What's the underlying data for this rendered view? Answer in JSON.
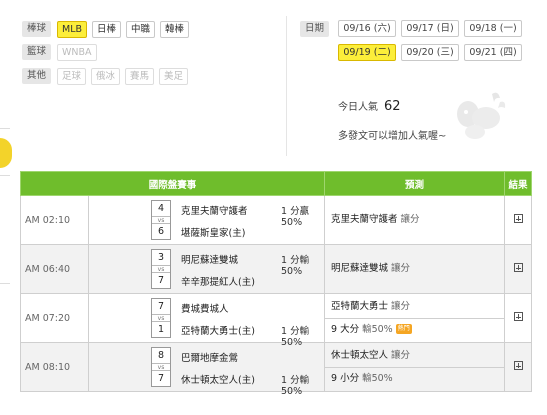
{
  "filters": {
    "rows": [
      {
        "label": "棒球",
        "chips": [
          {
            "text": "MLB",
            "state": "active"
          },
          {
            "text": "日棒",
            "state": "normal"
          },
          {
            "text": "中職",
            "state": "normal"
          },
          {
            "text": "韓棒",
            "state": "normal"
          }
        ]
      },
      {
        "label": "籃球",
        "chips": [
          {
            "text": "WNBA",
            "state": "disabled"
          }
        ]
      },
      {
        "label": "其他",
        "chips": [
          {
            "text": "足球",
            "state": "disabled"
          },
          {
            "text": "俄冰",
            "state": "disabled"
          },
          {
            "text": "賽馬",
            "state": "disabled"
          },
          {
            "text": "美足",
            "state": "disabled"
          }
        ]
      }
    ]
  },
  "dates": {
    "label": "日期",
    "items": [
      {
        "text": "09/16 (六)",
        "active": false
      },
      {
        "text": "09/17 (日)",
        "active": false
      },
      {
        "text": "09/18 (一)",
        "active": false
      },
      {
        "text": "09/19 (二)",
        "active": true
      },
      {
        "text": "09/20 (三)",
        "active": false
      },
      {
        "text": "09/21 (四)",
        "active": false
      }
    ]
  },
  "popularity": {
    "label": "今日人氣",
    "value": "62"
  },
  "encourage_text": "多發文可以增加人氣喔~",
  "table": {
    "headers": {
      "match": "國際盤賽事",
      "pick": "預測",
      "result": "結果"
    },
    "rows": [
      {
        "time": "AM 02:10",
        "score1": "4",
        "score2": "6",
        "vs": "vs",
        "team1": "克里夫蘭守護者",
        "team2": "堪薩斯皇家(主)",
        "odds1": "1 分贏50%",
        "odds2": "",
        "picks": [
          {
            "team": "克里夫蘭守護者",
            "type": "讓分",
            "hot": ""
          }
        ]
      },
      {
        "time": "AM 06:40",
        "score1": "3",
        "score2": "7",
        "vs": "vs",
        "team1": "明尼蘇達雙城",
        "team2": "辛辛那提紅人(主)",
        "odds1": "1 分輸50%",
        "odds2": "",
        "picks": [
          {
            "team": "明尼蘇達雙城",
            "type": "讓分",
            "hot": ""
          }
        ]
      },
      {
        "time": "AM 07:20",
        "score1": "7",
        "score2": "1",
        "vs": "vs",
        "team1": "費城費城人",
        "team2": "亞特蘭大勇士(主)",
        "odds1": "",
        "odds2": "1 分輸50%",
        "picks": [
          {
            "team": "亞特蘭大勇士",
            "type": "讓分",
            "hot": ""
          },
          {
            "team": "9 大分",
            "type": "輸50%",
            "hot": "熱門"
          }
        ]
      },
      {
        "time": "AM 08:10",
        "score1": "8",
        "score2": "7",
        "vs": "vs",
        "team1": "巴爾地摩金鶯",
        "team2": "休士頓太空人(主)",
        "odds1": "",
        "odds2": "1 分輸50%",
        "picks": [
          {
            "team": "休士頓太空人",
            "type": "讓分",
            "hot": ""
          },
          {
            "team": "9 小分",
            "type": "輸50%",
            "hot": ""
          }
        ]
      }
    ]
  },
  "colors": {
    "accent_yellow": "#fcee3a",
    "header_green": "#6fbd2c"
  }
}
